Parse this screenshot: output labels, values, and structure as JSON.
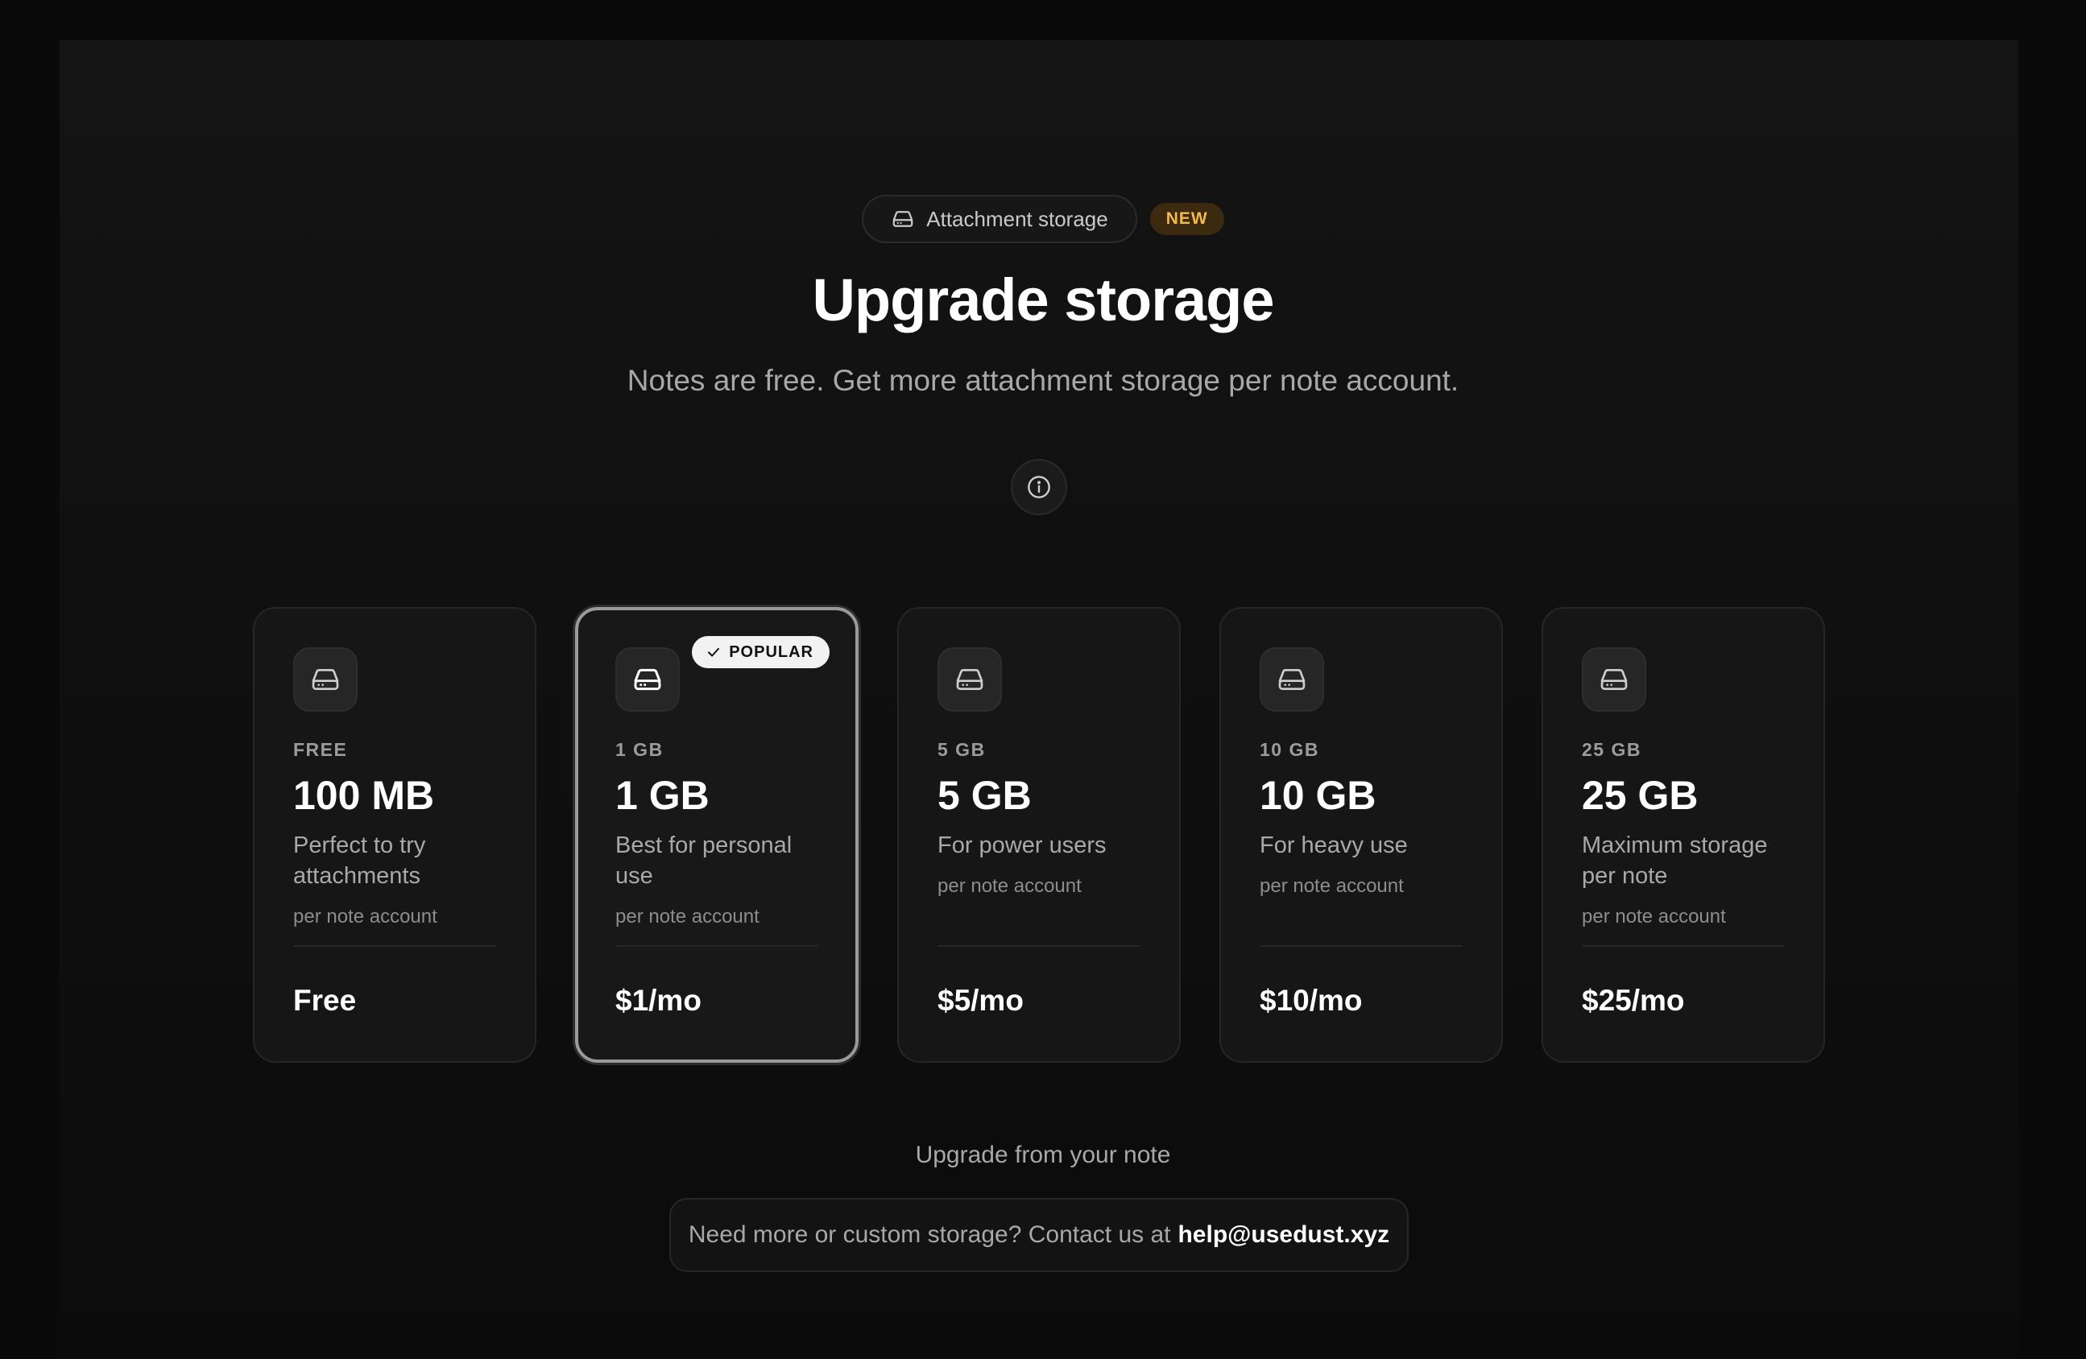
{
  "header": {
    "pill_label": "Attachment storage",
    "pill_icon": "hard-drive-icon",
    "new_badge": "NEW",
    "title": "Upgrade storage",
    "subtitle": "Notes are free. Get more attachment storage per note account.",
    "info_icon": "info-icon"
  },
  "plans": [
    {
      "tier": "FREE",
      "size": "100 MB",
      "desc": "Perfect to try attachments",
      "per": "per note account",
      "price": "Free",
      "popular": false
    },
    {
      "tier": "1 GB",
      "size": "1 GB",
      "desc": "Best for personal use",
      "per": "per note account",
      "price": "$1/mo",
      "popular": true,
      "badge": "POPULAR"
    },
    {
      "tier": "5 GB",
      "size": "5 GB",
      "desc": "For power users",
      "per": "per note account",
      "price": "$5/mo",
      "popular": false
    },
    {
      "tier": "10 GB",
      "size": "10 GB",
      "desc": "For heavy use",
      "per": "per note account",
      "price": "$10/mo",
      "popular": false
    },
    {
      "tier": "25 GB",
      "size": "25 GB",
      "desc": "Maximum storage per note",
      "per": "per note account",
      "price": "$25/mo",
      "popular": false
    }
  ],
  "footer": {
    "upgrade_note": "Upgrade from your note",
    "contact_text": "Need more or custom storage? Contact us at",
    "contact_email": "help@usedust.xyz"
  },
  "colors": {
    "background": "#0a0a0a",
    "card": "#161616",
    "new_badge_text": "#f5b94a",
    "popular_border": "#9a9a9a"
  }
}
